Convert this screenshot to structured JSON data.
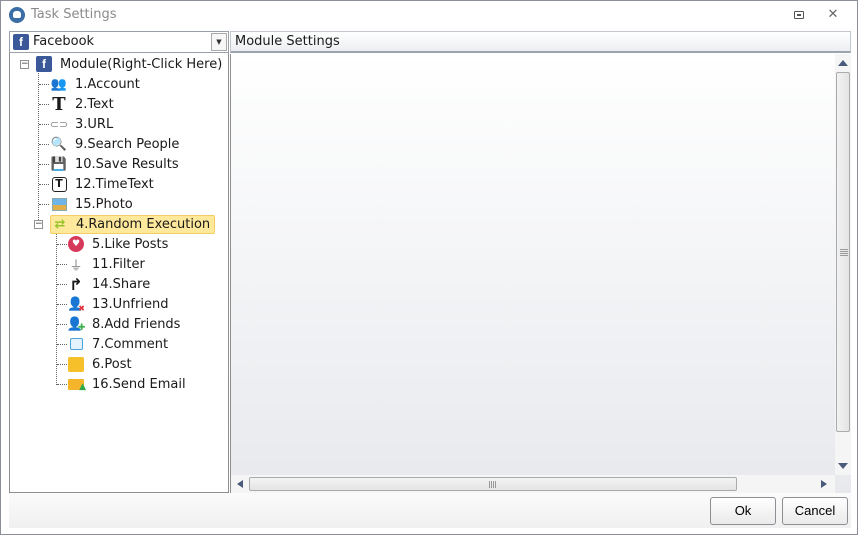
{
  "window": {
    "title": "Task Settings",
    "restore_icon": "restore-icon",
    "close_icon": "close-icon",
    "close_glyph": "✕"
  },
  "platform_select": {
    "value": "Facebook",
    "icon": "facebook-icon",
    "icon_glyph": "f",
    "arrow_glyph": "▼"
  },
  "tree": {
    "root": {
      "label": "Module(Right-Click Here)",
      "icon": "facebook-icon",
      "expanded": true
    },
    "children": [
      {
        "label": "1.Account",
        "icon": "users-icon"
      },
      {
        "label": "2.Text",
        "icon": "text-icon"
      },
      {
        "label": "3.URL",
        "icon": "link-icon"
      },
      {
        "label": "9.Search People",
        "icon": "search-icon"
      },
      {
        "label": "10.Save Results",
        "icon": "save-icon"
      },
      {
        "label": "12.TimeText",
        "icon": "time-text-icon"
      },
      {
        "label": "15.Photo",
        "icon": "photo-icon"
      },
      {
        "label": "4.Random Execution",
        "icon": "shuffle-icon",
        "selected": true,
        "expanded": true,
        "children": [
          {
            "label": "5.Like Posts",
            "icon": "heart-icon"
          },
          {
            "label": "11.Filter",
            "icon": "filter-icon"
          },
          {
            "label": "14.Share",
            "icon": "share-icon"
          },
          {
            "label": "13.Unfriend",
            "icon": "remove-user-icon"
          },
          {
            "label": "8.Add Friends",
            "icon": "add-user-icon"
          },
          {
            "label": "7.Comment",
            "icon": "comment-icon"
          },
          {
            "label": "6.Post",
            "icon": "note-icon"
          },
          {
            "label": "16.Send Email",
            "icon": "email-icon"
          }
        ]
      }
    ]
  },
  "module_settings": {
    "title": "Module Settings"
  },
  "buttons": {
    "ok": "Ok",
    "cancel": "Cancel"
  },
  "colors": {
    "selection_bg": "#fde89b",
    "selection_border": "#f3cf63",
    "facebook_blue": "#3b5998",
    "scroll_arrow": "#4a5a7a"
  }
}
